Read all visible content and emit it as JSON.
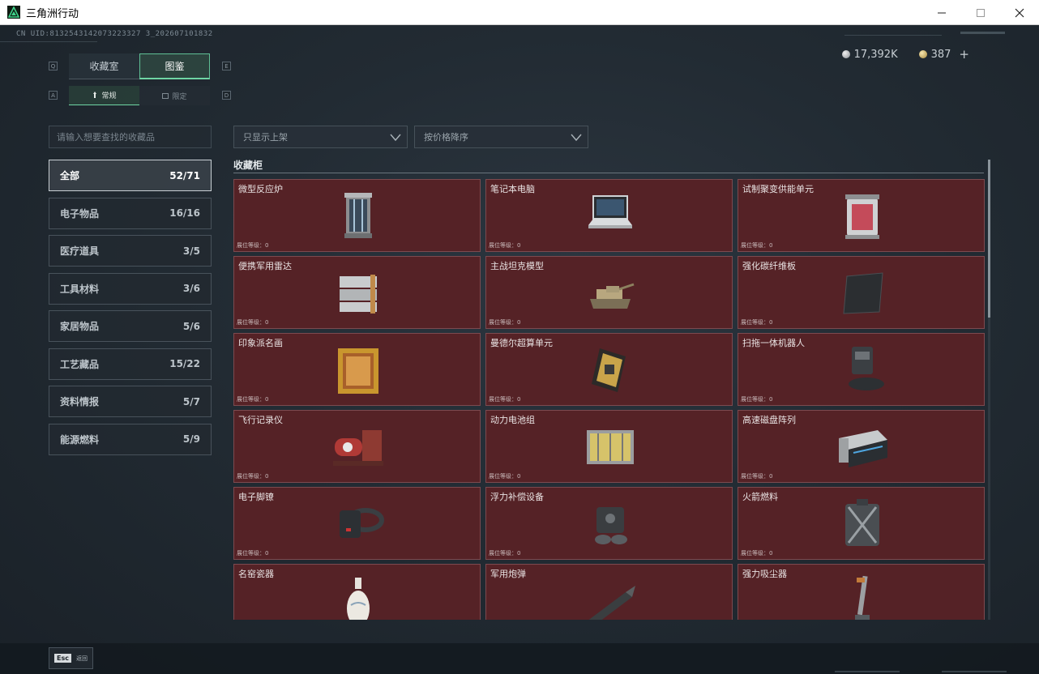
{
  "window": {
    "title": "三角洲行动",
    "minimize_label": "—",
    "maximize_label": "☐",
    "close_label": "✕"
  },
  "header": {
    "uid": "CN UID:8132543142073223327 3_202607101832",
    "currency": [
      {
        "icon": "silver-coin-icon",
        "value": "17,392K"
      },
      {
        "icon": "gold-coin-icon",
        "value": "387"
      }
    ],
    "add_label": "+"
  },
  "tabs": {
    "key_left": "Q",
    "key_right": "E",
    "items": [
      {
        "label": "收藏室",
        "active": false
      },
      {
        "label": "图鉴",
        "active": true
      }
    ]
  },
  "subtabs": {
    "key_left": "A",
    "key_right": "D",
    "items": [
      {
        "label": "常规",
        "active": true
      },
      {
        "label": "限定",
        "active": false
      }
    ]
  },
  "search": {
    "placeholder": "请输入想要查找的收藏品",
    "value": ""
  },
  "filters": {
    "shelf": "只显示上架",
    "sort": "按价格降序"
  },
  "categories": [
    {
      "label": "全部",
      "count": "52/71",
      "active": true
    },
    {
      "label": "电子物品",
      "count": "16/16",
      "active": false
    },
    {
      "label": "医疗道具",
      "count": "3/5",
      "active": false
    },
    {
      "label": "工具材料",
      "count": "3/6",
      "active": false
    },
    {
      "label": "家居物品",
      "count": "5/6",
      "active": false
    },
    {
      "label": "工艺藏品",
      "count": "15/22",
      "active": false
    },
    {
      "label": "资料情报",
      "count": "5/7",
      "active": false
    },
    {
      "label": "能源燃料",
      "count": "5/9",
      "active": false
    }
  ],
  "collection": {
    "section_title": "收藏柜",
    "level_label": "展位等级：0",
    "items": [
      {
        "name": "微型反应炉",
        "icon": "reactor-icon"
      },
      {
        "name": "笔记本电脑",
        "icon": "laptop-icon"
      },
      {
        "name": "试制聚变供能单元",
        "icon": "fusion-unit-icon"
      },
      {
        "name": "便携军用雷达",
        "icon": "radar-icon"
      },
      {
        "name": "主战坦克模型",
        "icon": "tank-model-icon"
      },
      {
        "name": "强化碳纤维板",
        "icon": "carbon-plate-icon"
      },
      {
        "name": "印象派名画",
        "icon": "painting-icon"
      },
      {
        "name": "曼德尔超算单元",
        "icon": "supercomputer-icon"
      },
      {
        "name": "扫拖一体机器人",
        "icon": "robot-vacuum-icon"
      },
      {
        "name": "飞行记录仪",
        "icon": "flight-recorder-icon"
      },
      {
        "name": "动力电池组",
        "icon": "battery-pack-icon"
      },
      {
        "name": "高速磁盘阵列",
        "icon": "disk-array-icon"
      },
      {
        "name": "电子脚镣",
        "icon": "ankle-monitor-icon"
      },
      {
        "name": "浮力补偿设备",
        "icon": "buoyancy-device-icon"
      },
      {
        "name": "火箭燃料",
        "icon": "rocket-fuel-icon"
      },
      {
        "name": "名窑瓷器",
        "icon": "porcelain-vase-icon"
      },
      {
        "name": "军用炮弹",
        "icon": "artillery-shell-icon"
      },
      {
        "name": "强力吸尘器",
        "icon": "vacuum-cleaner-icon"
      }
    ]
  },
  "footer": {
    "esc_key": "Esc",
    "back_label": "返回"
  },
  "colors": {
    "card_bg": "#552226",
    "accent": "#6fd6a4"
  }
}
